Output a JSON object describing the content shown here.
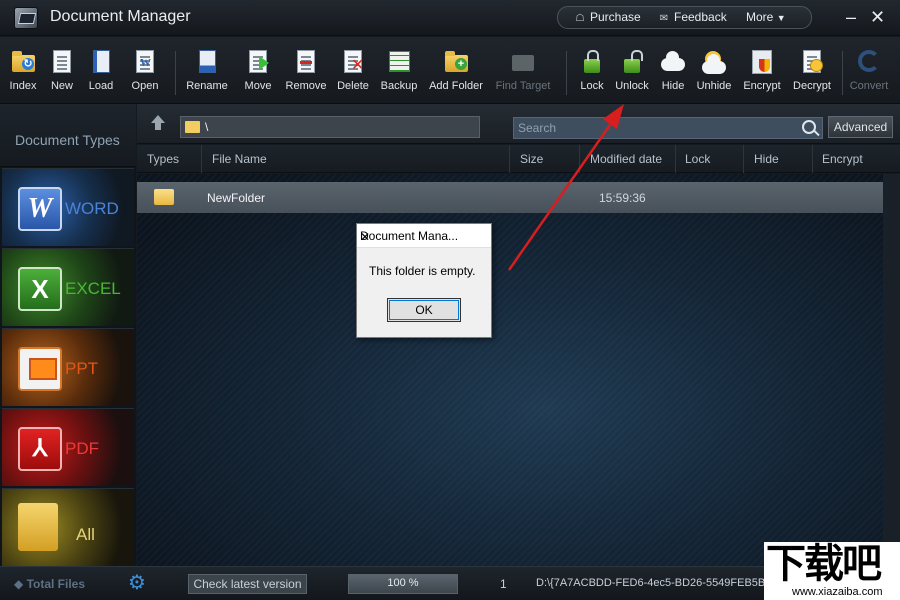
{
  "window": {
    "title": "Document Manager",
    "links": {
      "purchase": "Purchase",
      "feedback": "Feedback",
      "more": "More"
    },
    "controls": {
      "minimize": "–",
      "close": "✕"
    }
  },
  "toolbar": {
    "items": [
      {
        "label": "Index",
        "icon": "folder-search-icon"
      },
      {
        "label": "New",
        "icon": "new-document-icon"
      },
      {
        "label": "Load",
        "icon": "load-icon"
      },
      {
        "label": "Open",
        "icon": "open-icon"
      },
      {
        "label": "Rename",
        "icon": "rename-icon"
      },
      {
        "label": "Move",
        "icon": "move-icon"
      },
      {
        "label": "Remove",
        "icon": "remove-icon"
      },
      {
        "label": "Delete",
        "icon": "delete-icon"
      },
      {
        "label": "Backup",
        "icon": "backup-icon"
      },
      {
        "label": "Add Folder",
        "icon": "add-folder-icon"
      },
      {
        "label": "Find Target",
        "icon": "find-target-icon",
        "disabled": true
      },
      {
        "label": "Lock",
        "icon": "lock-icon"
      },
      {
        "label": "Unlock",
        "icon": "unlock-icon"
      },
      {
        "label": "Hide",
        "icon": "hide-icon"
      },
      {
        "label": "Unhide",
        "icon": "unhide-icon"
      },
      {
        "label": "Encrypt",
        "icon": "encrypt-icon"
      },
      {
        "label": "Decrypt",
        "icon": "decrypt-icon"
      },
      {
        "label": "Convert",
        "icon": "convert-icon",
        "disabled": true
      }
    ]
  },
  "sidebar": {
    "heading": "Document Types",
    "categories": [
      {
        "label": "WORD",
        "icon": "word-icon",
        "color": "#4b83d6"
      },
      {
        "label": "EXCEL",
        "icon": "excel-icon",
        "color": "#49b834"
      },
      {
        "label": "PPT",
        "icon": "ppt-icon",
        "color": "#e25717"
      },
      {
        "label": "PDF",
        "icon": "pdf-icon",
        "color": "#ec3a3a"
      },
      {
        "label": "All",
        "icon": "all-files-icon",
        "color": "#e8d27a"
      }
    ]
  },
  "pathbar": {
    "path": "\\",
    "search_placeholder": "Search",
    "advanced_label": "Advanced"
  },
  "columns": [
    "Types",
    "File Name",
    "Size",
    "Modified date",
    "Lock",
    "Hide",
    "Encrypt"
  ],
  "files": [
    {
      "type_icon": "folder-icon",
      "name": "NewFolder",
      "size": "",
      "modified": "15:59:36",
      "lock": "",
      "hide": "",
      "encrypt": ""
    }
  ],
  "dialog": {
    "title": "Document Mana...",
    "message": "This folder is empty.",
    "ok_label": "OK"
  },
  "statusbar": {
    "total_files_label": "Total Files",
    "check_version_label": "Check latest version",
    "progress_text": "100 %",
    "progress_value": 1.0,
    "count": "1",
    "full_path": "D:\\{7A7ACBDD-FED6-4ec5-BD26-5549FEB5BS"
  },
  "watermark": {
    "text": "下载吧",
    "url": "www.xiazaiba.com"
  },
  "colors": {
    "accent": "#3d8fd8",
    "annotation_arrow": "#d81e1e",
    "selected_row": "#525c65"
  }
}
